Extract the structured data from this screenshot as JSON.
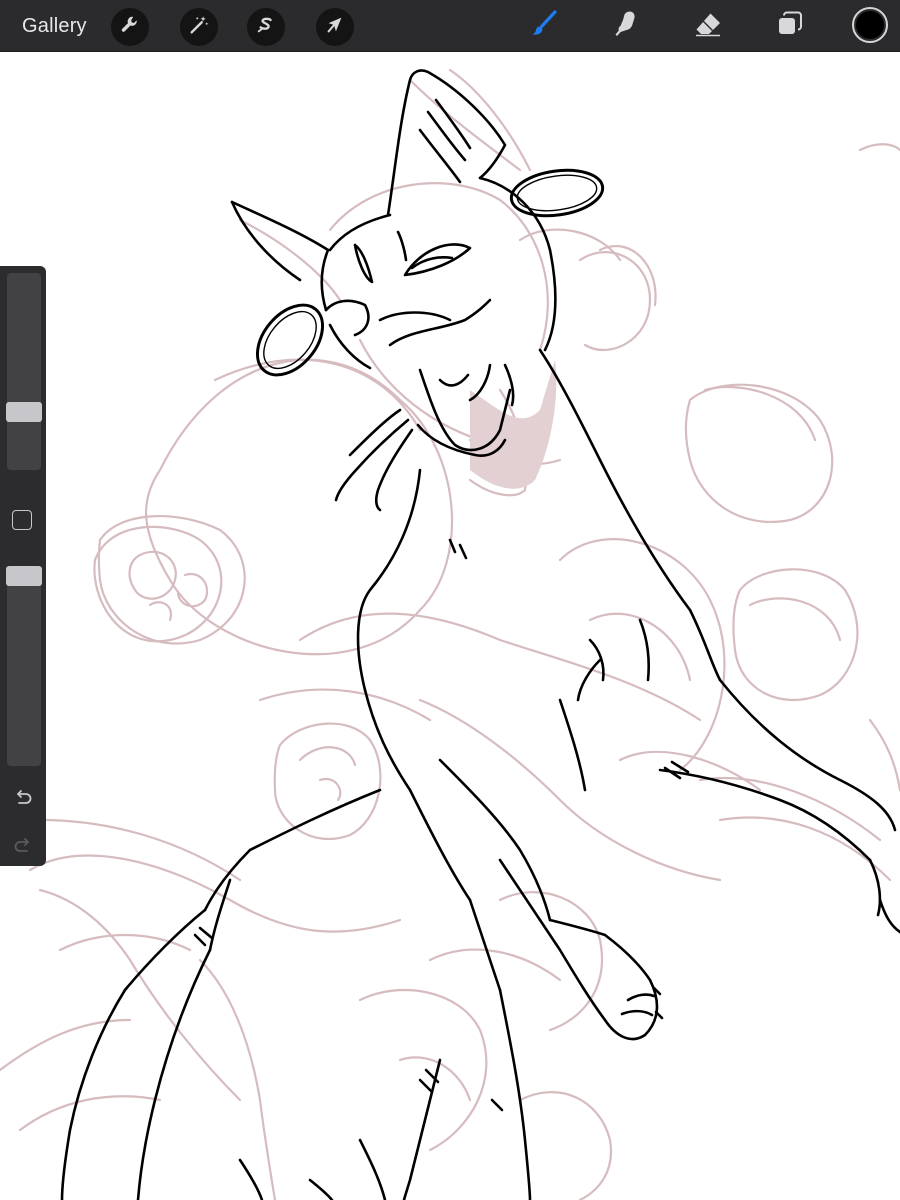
{
  "toolbar": {
    "gallery_label": "Gallery",
    "left_tools": [
      {
        "name": "actions",
        "icon": "wrench-icon"
      },
      {
        "name": "adjustments",
        "icon": "magic-wand-icon"
      },
      {
        "name": "selection",
        "icon": "selection-s-icon"
      },
      {
        "name": "transform",
        "icon": "arrow-cursor-icon"
      }
    ],
    "right_tools": [
      {
        "name": "brush",
        "icon": "brush-icon",
        "active": true
      },
      {
        "name": "smudge",
        "icon": "smudge-finger-icon",
        "active": false
      },
      {
        "name": "eraser",
        "icon": "eraser-icon",
        "active": false
      },
      {
        "name": "layers",
        "icon": "layers-icon",
        "active": false
      }
    ],
    "active_color": "#000000",
    "active_tool_color": "#1e7cf2",
    "icon_color": "#d8d8da"
  },
  "sidebar": {
    "brush_size_level": 0.27,
    "brush_opacity_level": 1.0,
    "modify_button_icon": "square-icon",
    "undo_icon": "undo-icon",
    "redo_icon": "redo-icon"
  },
  "canvas": {
    "background": "#ffffff",
    "sketch_color": "#d4b8bc",
    "lineart_color": "#000000"
  }
}
